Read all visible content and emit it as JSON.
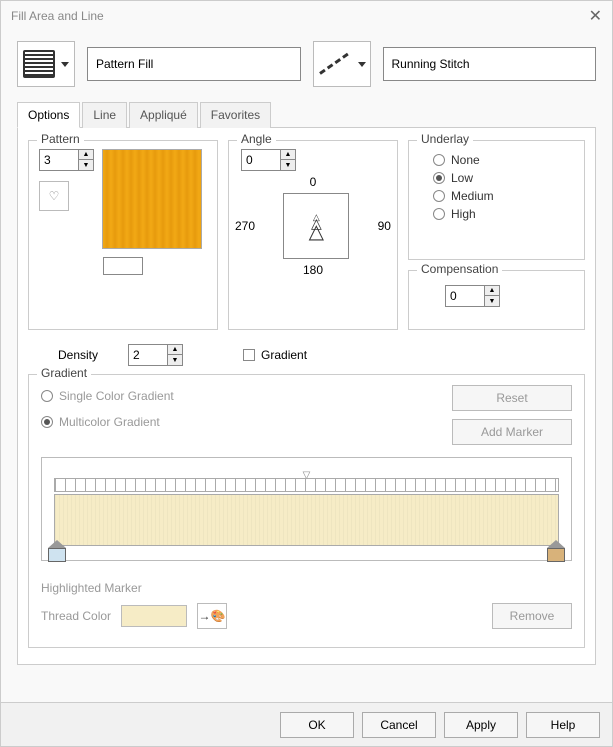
{
  "title": "Fill Area and Line",
  "top": {
    "fill_select": "Pattern Fill",
    "line_select": "Running Stitch"
  },
  "tabs": [
    "Options",
    "Line",
    "Appliqué",
    "Favorites"
  ],
  "active_tab": 0,
  "pattern": {
    "label": "Pattern",
    "value": "3"
  },
  "angle": {
    "label": "Angle",
    "value": "0",
    "top_label": "0",
    "right_label": "90",
    "bottom_label": "180",
    "left_label": "270"
  },
  "underlay": {
    "label": "Underlay",
    "options": [
      "None",
      "Low",
      "Medium",
      "High"
    ],
    "selected": 1
  },
  "compensation": {
    "label": "Compensation",
    "value": "0"
  },
  "density": {
    "label": "Density",
    "value": "2",
    "gradient_checkbox": "Gradient"
  },
  "gradient": {
    "label": "Gradient",
    "single_label": "Single Color Gradient",
    "multi_label": "Multicolor Gradient",
    "selected": 1,
    "reset": "Reset",
    "add_marker": "Add Marker",
    "highlighted": "Highlighted Marker",
    "thread_color": "Thread Color",
    "remove": "Remove"
  },
  "footer": {
    "ok": "OK",
    "cancel": "Cancel",
    "apply": "Apply",
    "help": "Help"
  }
}
